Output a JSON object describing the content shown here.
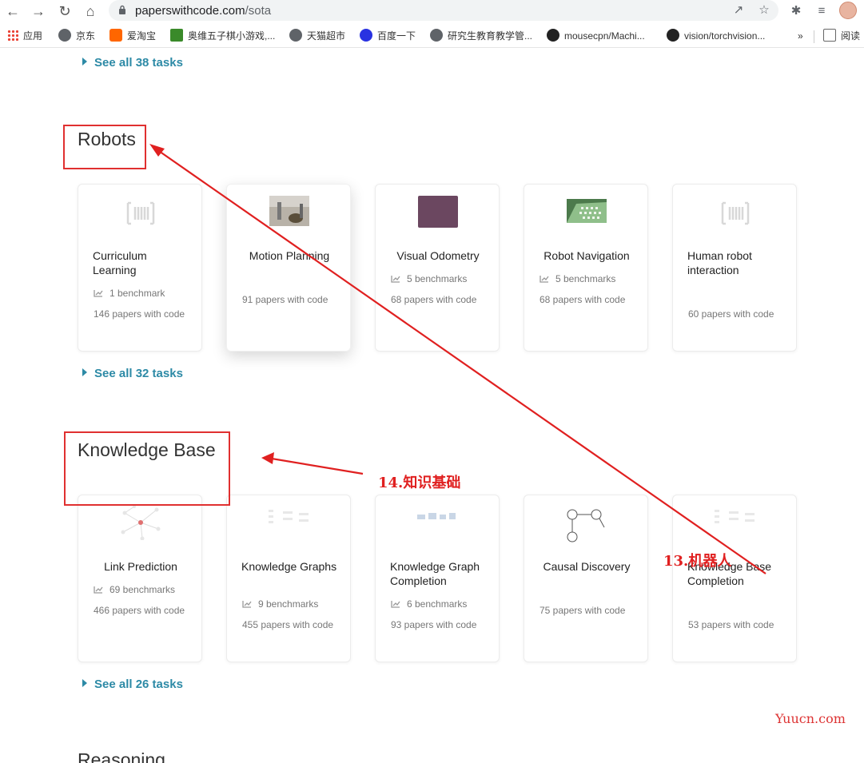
{
  "browser": {
    "url_host": "paperswithcode.com",
    "url_path": "/sota",
    "bookmarks": [
      {
        "label": "应用",
        "icon": "apps-grid-icon"
      },
      {
        "label": "京东",
        "icon": "globe-icon"
      },
      {
        "label": "爱淘宝",
        "icon": "taobao-icon"
      },
      {
        "label": "奥维五子棋小游戏,...",
        "icon": "game-icon"
      },
      {
        "label": "天猫超市",
        "icon": "globe-icon"
      },
      {
        "label": "百度一下",
        "icon": "baidu-icon"
      },
      {
        "label": "研究生教育教学管...",
        "icon": "globe-icon"
      },
      {
        "label": "mousecpn/Machi...",
        "icon": "github-icon"
      },
      {
        "label": "vision/torchvision...",
        "icon": "github-icon"
      },
      {
        "label": "»",
        "icon": "more-bookmarks-icon"
      },
      {
        "label": "阅读",
        "icon": "reading-list-icon"
      }
    ]
  },
  "page": {
    "prev_see_all": "See all 38 tasks",
    "sections": [
      {
        "title": "Robots",
        "see_all": "See all 32 tasks",
        "cards": [
          {
            "title": "Curriculum Learning",
            "benchmarks": "1 benchmark",
            "papers": "146 papers with code"
          },
          {
            "title": "Motion Planning",
            "benchmarks": "",
            "papers": "91 papers with code"
          },
          {
            "title": "Visual Odometry",
            "benchmarks": "5 benchmarks",
            "papers": "68 papers with code"
          },
          {
            "title": "Robot Navigation",
            "benchmarks": "5 benchmarks",
            "papers": "68 papers with code"
          },
          {
            "title": "Human robot interaction",
            "benchmarks": "",
            "papers": "60 papers with code"
          }
        ]
      },
      {
        "title": "Knowledge Base",
        "see_all": "See all 26 tasks",
        "cards": [
          {
            "title": "Link Prediction",
            "benchmarks": "69 benchmarks",
            "papers": "466 papers with code"
          },
          {
            "title": "Knowledge Graphs",
            "benchmarks": "9 benchmarks",
            "papers": "455 papers with code"
          },
          {
            "title": "Knowledge Graph Completion",
            "benchmarks": "6 benchmarks",
            "papers": "93 papers with code"
          },
          {
            "title": "Causal Discovery",
            "benchmarks": "",
            "papers": "75 papers with code"
          },
          {
            "title": "Knowledge Base Completion",
            "benchmarks": "",
            "papers": "53 papers with code"
          }
        ]
      },
      {
        "title": "Reasoning"
      }
    ]
  },
  "annotations": {
    "label_knowledge": "14.知识基础",
    "label_robots": "13.机器人",
    "watermark": "Yuucn.com",
    "color": "#e02020"
  }
}
